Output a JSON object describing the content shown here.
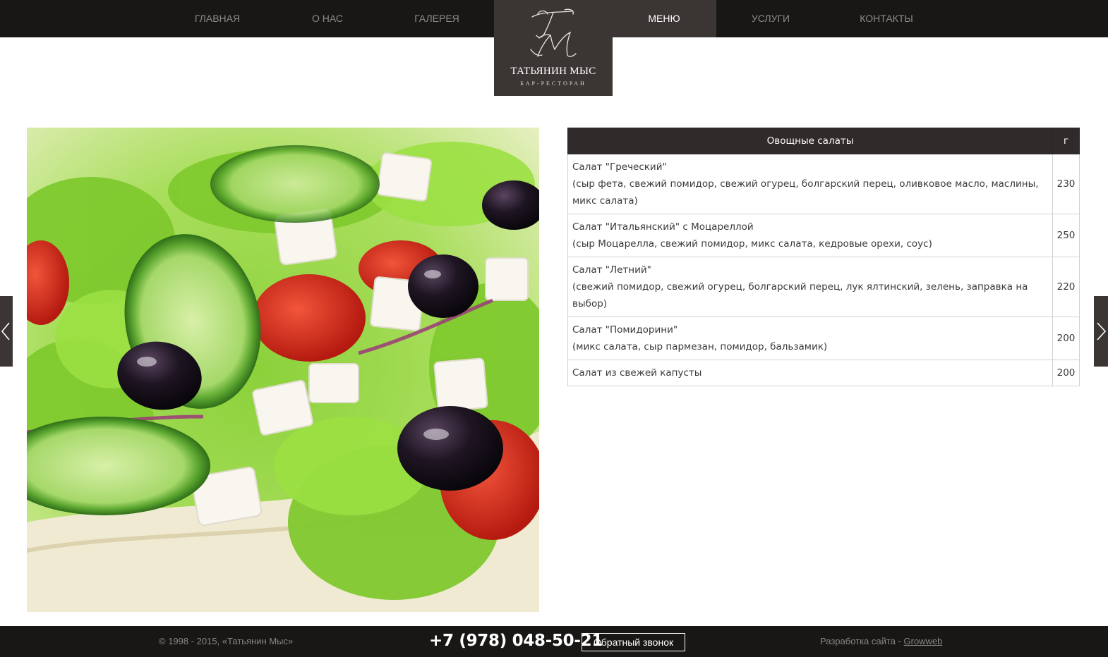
{
  "nav": {
    "items": [
      {
        "label": "ГЛАВНАЯ"
      },
      {
        "label": "О НАС"
      },
      {
        "label": "ГАЛЕРЕЯ"
      },
      {
        "label": "МЕНЮ"
      },
      {
        "label": "УСЛУГИ"
      },
      {
        "label": "КОНТАКТЫ"
      }
    ],
    "active": "МЕНЮ"
  },
  "logo": {
    "monogram": "ТМ",
    "name": "ТАТЬЯНИН МЫС",
    "subtitle": "БАР-РЕСТОРАН"
  },
  "photo": {
    "icon": "salad-photo"
  },
  "menu": {
    "header_name": "Овощные салаты",
    "header_weight": "г",
    "items": [
      {
        "name": "Салат \"Греческий\"",
        "desc": "(сыр фета, свежий помидор, свежий огурец, болгарский перец, оливковое масло, маслины, микс салата)",
        "weight": "230"
      },
      {
        "name": "Салат \"Итальянский\" с Моцареллой",
        "desc": "(сыр Моцарелла, свежий помидор, микс салата, кедровые орехи, соус)",
        "weight": "250"
      },
      {
        "name": "Салат \"Летний\"",
        "desc": "(свежий помидор, свежий огурец, болгарский перец, лук ялтинский, зелень, заправка на выбор)",
        "weight": "220"
      },
      {
        "name": "Салат \"Помидорини\"",
        "desc": "(микс салата, сыр пармезан, помидор, бальзамик)",
        "weight": "200"
      },
      {
        "name": "Салат из свежей капусты",
        "desc": "",
        "weight": "200"
      }
    ]
  },
  "arrows": {
    "left_icon": "chevron-left-icon",
    "right_icon": "chevron-right-icon"
  },
  "footer": {
    "copyright": "© 1998 - 2015, «Татьянин Мыс»",
    "phone": "+7 (978) 048-50-21",
    "callback_label": "Обратный звонок",
    "dev_prefix": "Разработка сайта - ",
    "dev_link": "Growweb"
  },
  "colors": {
    "bar_bg": "#191716",
    "active_bg": "#3b3634",
    "table_header_bg": "#302b2a"
  }
}
